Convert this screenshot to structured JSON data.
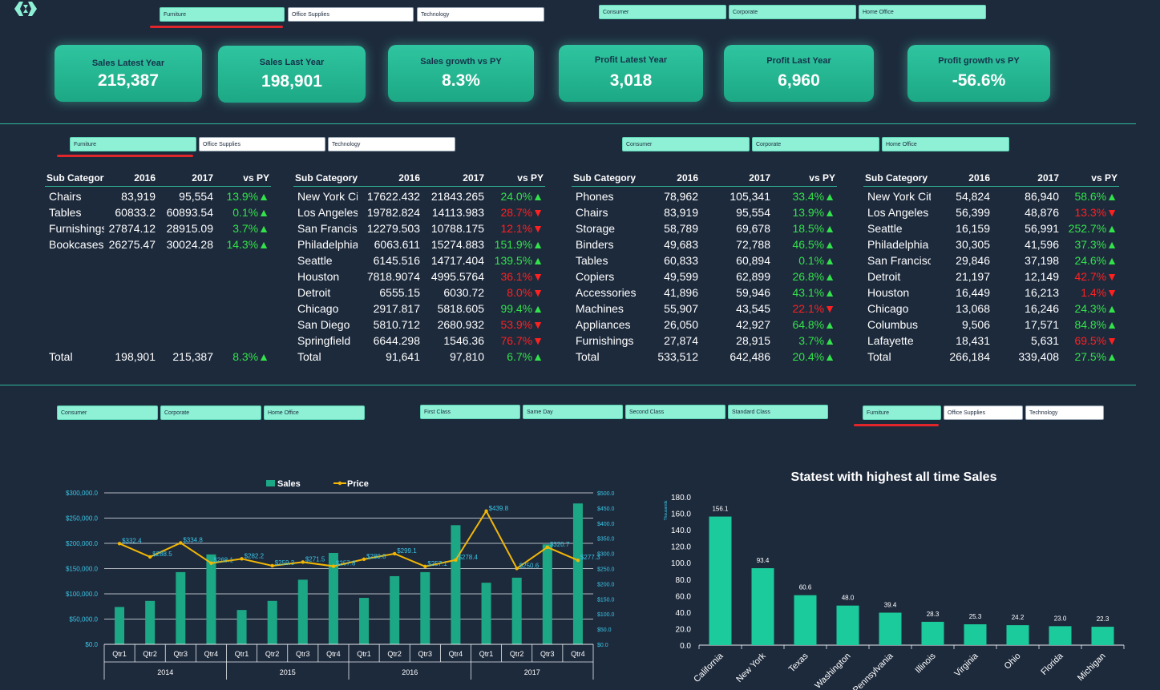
{
  "colors": {
    "background": "#1d2a3c",
    "accent": "#25c59c",
    "selected_slicer": "#8ef1d6",
    "positive": "#32e24a",
    "negative": "#ff2020",
    "price_line": "#f2b705"
  },
  "top_slicers": {
    "category": [
      "Furniture",
      "Office Supplies",
      "Technology"
    ],
    "segment": [
      "Consumer",
      "Corporate",
      "Home Office"
    ]
  },
  "kpis": [
    {
      "title": "Sales Latest Year",
      "value": "215,387"
    },
    {
      "title": "Sales Last Year",
      "value": "198,901"
    },
    {
      "title": "Sales growth vs PY",
      "value": "8.3%"
    },
    {
      "title": "Profit  Latest Year",
      "value": "3,018"
    },
    {
      "title": "Profit  Last Year",
      "value": "6,960"
    },
    {
      "title": "Profit  growth vs PY",
      "value": "-56.6%"
    }
  ],
  "mid_slicers": {
    "category": [
      "Furniture",
      "Office Supplies",
      "Technology"
    ],
    "segment": [
      "Consumer",
      "Corporate",
      "Home Office"
    ]
  },
  "tables": [
    {
      "headers": [
        "Sub Category",
        "2016",
        "2017",
        "vs PY"
      ],
      "rows": [
        [
          "Chairs",
          "83,919",
          "95,554",
          "13.9%",
          "up"
        ],
        [
          "Tables",
          "60833.2",
          "60893.54",
          "0.1%",
          "up"
        ],
        [
          "Furnishings",
          "27874.12",
          "28915.09",
          "3.7%",
          "up"
        ],
        [
          "Bookcases",
          "26275.47",
          "30024.28",
          "14.3%",
          "up"
        ]
      ],
      "total": [
        "Total",
        "198,901",
        "215,387",
        "8.3%",
        "up"
      ]
    },
    {
      "headers": [
        "Sub Category",
        "2016",
        "2017",
        "vs PY"
      ],
      "rows": [
        [
          "New York City",
          "17622.432",
          "21843.265",
          "24.0%",
          "up"
        ],
        [
          "Los Angeles",
          "19782.824",
          "14113.983",
          "28.7%",
          "down"
        ],
        [
          "San Francisco",
          "12279.503",
          "10788.175",
          "12.1%",
          "down"
        ],
        [
          "Philadelphia",
          "6063.611",
          "15274.883",
          "151.9%",
          "up"
        ],
        [
          "Seattle",
          "6145.516",
          "14717.404",
          "139.5%",
          "up"
        ],
        [
          "Houston",
          "7818.9074",
          "4995.5764",
          "36.1%",
          "down"
        ],
        [
          "Detroit",
          "6555.15",
          "6030.72",
          "8.0%",
          "down"
        ],
        [
          "Chicago",
          "2917.817",
          "5818.605",
          "99.4%",
          "up"
        ],
        [
          "San Diego",
          "5810.712",
          "2680.932",
          "53.9%",
          "down"
        ],
        [
          "Springfield",
          "6644.298",
          "1546.36",
          "76.7%",
          "down"
        ]
      ],
      "total": [
        "Total",
        "91,641",
        "97,810",
        "6.7%",
        "up"
      ]
    },
    {
      "headers": [
        "Sub Category",
        "2016",
        "2017",
        "vs PY"
      ],
      "rows": [
        [
          "Phones",
          "78,962",
          "105,341",
          "33.4%",
          "up"
        ],
        [
          "Chairs",
          "83,919",
          "95,554",
          "13.9%",
          "up"
        ],
        [
          "Storage",
          "58,789",
          "69,678",
          "18.5%",
          "up"
        ],
        [
          "Binders",
          "49,683",
          "72,788",
          "46.5%",
          "up"
        ],
        [
          "Tables",
          "60,833",
          "60,894",
          "0.1%",
          "up"
        ],
        [
          "Copiers",
          "49,599",
          "62,899",
          "26.8%",
          "up"
        ],
        [
          "Accessories",
          "41,896",
          "59,946",
          "43.1%",
          "up"
        ],
        [
          "Machines",
          "55,907",
          "43,545",
          "22.1%",
          "down"
        ],
        [
          "Appliances",
          "26,050",
          "42,927",
          "64.8%",
          "up"
        ],
        [
          "Furnishings",
          "27,874",
          "28,915",
          "3.7%",
          "up"
        ]
      ],
      "total": [
        "Total",
        "533,512",
        "642,486",
        "20.4%",
        "up"
      ]
    },
    {
      "headers": [
        "Sub Category",
        "2016",
        "2017",
        "vs PY"
      ],
      "rows": [
        [
          "New York City",
          "54,824",
          "86,940",
          "58.6%",
          "up"
        ],
        [
          "Los Angeles",
          "56,399",
          "48,876",
          "13.3%",
          "down"
        ],
        [
          "Seattle",
          "16,159",
          "56,991",
          "252.7%",
          "up"
        ],
        [
          "Philadelphia",
          "30,305",
          "41,596",
          "37.3%",
          "up"
        ],
        [
          "San Francisco",
          "29,846",
          "37,198",
          "24.6%",
          "up"
        ],
        [
          "Detroit",
          "21,197",
          "12,149",
          "42.7%",
          "down"
        ],
        [
          "Houston",
          "16,449",
          "16,213",
          "1.4%",
          "down"
        ],
        [
          "Chicago",
          "13,068",
          "16,246",
          "24.3%",
          "up"
        ],
        [
          "Columbus",
          "9,506",
          "17,571",
          "84.8%",
          "up"
        ],
        [
          "Lafayette",
          "18,431",
          "5,631",
          "69.5%",
          "down"
        ]
      ],
      "total": [
        "Total",
        "266,184",
        "339,408",
        "27.5%",
        "up"
      ]
    }
  ],
  "bottom_slicers": {
    "segment": [
      "Consumer",
      "Corporate",
      "Home Office"
    ],
    "ship_mode": [
      "First Class",
      "Same Day",
      "Second Class",
      "Standard Class"
    ],
    "category": [
      "Furniture",
      "Office Supplies",
      "Technology"
    ]
  },
  "chart_data": [
    {
      "type": "bar",
      "title": "",
      "legend": {
        "placement": "top",
        "entries": [
          "Sales",
          "Price"
        ]
      },
      "x_groups": [
        {
          "year": "2014",
          "quarters": [
            "Qtr1",
            "Qtr2",
            "Qtr3",
            "Qtr4"
          ]
        },
        {
          "year": "2015",
          "quarters": [
            "Qtr1",
            "Qtr2",
            "Qtr3",
            "Qtr4"
          ]
        },
        {
          "year": "2016",
          "quarters": [
            "Qtr1",
            "Qtr2",
            "Qtr3",
            "Qtr4"
          ]
        },
        {
          "year": "2017",
          "quarters": [
            "Qtr1",
            "Qtr2",
            "Qtr3",
            "Qtr4"
          ]
        }
      ],
      "series": [
        {
          "name": "Sales",
          "type": "bar",
          "axis": "left",
          "values": [
            74000,
            86000,
            143000,
            178000,
            68000,
            86000,
            128000,
            181000,
            92000,
            135000,
            143000,
            236000,
            122000,
            132000,
            198000,
            279000
          ]
        },
        {
          "name": "Price",
          "type": "line",
          "axis": "right",
          "values": [
            332.4,
            288.5,
            334.8,
            268.1,
            282.2,
            259.3,
            271.5,
            257.8,
            280.8,
            299.1,
            257.1,
            278.4,
            439.8,
            250.6,
            320.7,
            277.3
          ],
          "labels": [
            "$332.4",
            "$288.5",
            "$334.8",
            "$268.1",
            "$282.2",
            "$259.3",
            "$271.5",
            "$257.8",
            "$280.8",
            "$299.1",
            "$257.1",
            "$278.4",
            "$439.8",
            "$250.6",
            "$320.7",
            "$277.3"
          ]
        }
      ],
      "y_left": {
        "ylim": [
          0,
          300000
        ],
        "ticks": [
          "$0.0",
          "$50,000.0",
          "$100,000.0",
          "$150,000.0",
          "$200,000.0",
          "$250,000.0",
          "$300,000.0"
        ]
      },
      "y_right": {
        "ylim": [
          0,
          500
        ],
        "ticks": [
          "$0.0",
          "$50.0",
          "$100.0",
          "$150.0",
          "$200.0",
          "$250.0",
          "$300.0",
          "$350.0",
          "$400.0",
          "$450.0",
          "$500.0"
        ]
      },
      "grid": true
    },
    {
      "type": "bar",
      "title": "Statest with highest all time Sales",
      "ylabel": "Thousands",
      "categories": [
        "California",
        "New York",
        "Texas",
        "Washington",
        "Pennsylvania",
        "Illinois",
        "Virginia",
        "Ohio",
        "Florida",
        "Michigan"
      ],
      "values": [
        156.1,
        93.4,
        60.6,
        48.0,
        39.4,
        28.3,
        25.3,
        24.2,
        23.0,
        22.3
      ],
      "value_labels": [
        "156.1",
        "93.4",
        "60.6",
        "48.0",
        "39.4",
        "28.3",
        "25.3",
        "24.2",
        "23.0",
        "22.3"
      ],
      "ylim": [
        0,
        180
      ],
      "ticks": [
        "0.0",
        "20.0",
        "40.0",
        "60.0",
        "80.0",
        "100.0",
        "120.0",
        "140.0",
        "160.0",
        "180.0"
      ],
      "grid": false
    }
  ]
}
